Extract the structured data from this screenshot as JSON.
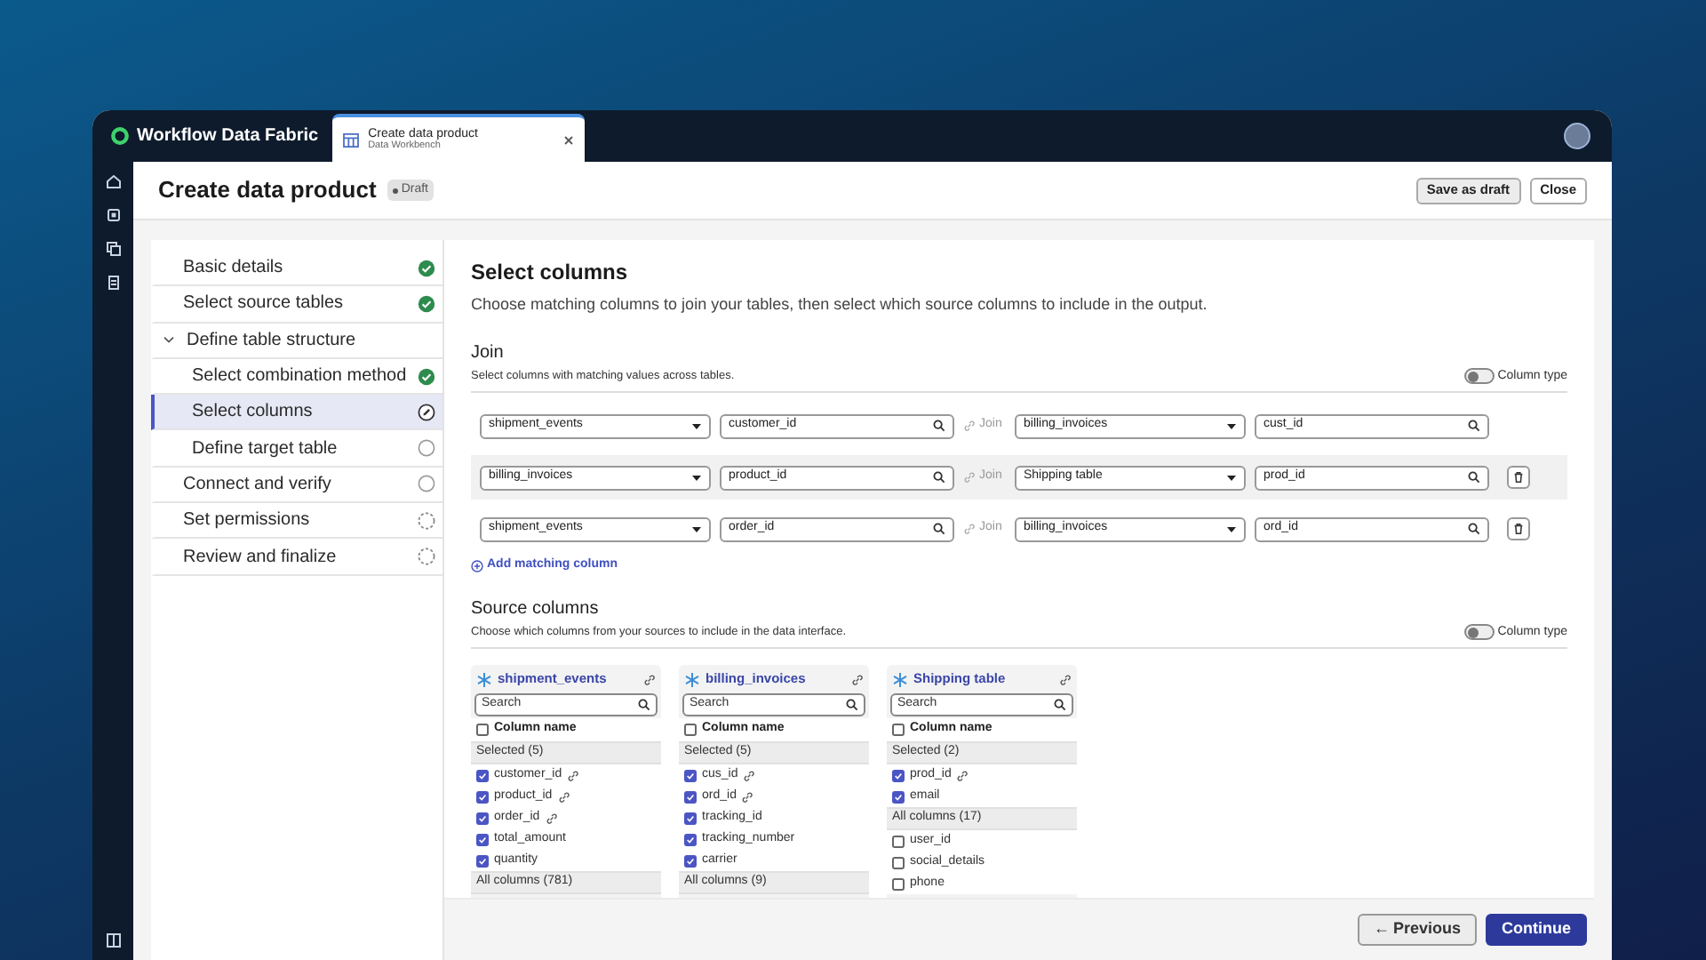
{
  "app": {
    "name": "Workflow Data Fabric"
  },
  "tabs": [
    {
      "title": "Create data product",
      "subtitle": "Data Workbench",
      "selected": true
    }
  ],
  "header": {
    "title": "Create data product",
    "badge": "Draft",
    "buttons": [
      "Save as draft",
      "Close"
    ]
  },
  "steps": [
    {
      "label": "Basic details",
      "kind": "done",
      "selected": false
    },
    {
      "label": "Select source tables",
      "kind": "done",
      "selected": false
    },
    {
      "label": "Define table structure",
      "expanded": true,
      "selected": false,
      "children": [
        {
          "label": "Select combination method",
          "kind": "done",
          "selected": false
        },
        {
          "label": "Select columns",
          "kind": "current",
          "selected": true
        },
        {
          "label": "Define target table",
          "kind": "pending",
          "selected": false
        }
      ]
    },
    {
      "label": "Connect and verify",
      "kind": "pending",
      "selected": false
    },
    {
      "label": "Set permissions",
      "kind": "locked",
      "selected": false
    },
    {
      "label": "Review and finalize",
      "kind": "locked",
      "selected": false
    }
  ],
  "page": {
    "title": "Select columns",
    "description": "Choose matching columns to join your tables, then select which source columns to include in the output."
  },
  "join": {
    "title": "Join",
    "description": "Select columns with matching values across tables.",
    "toggle": {
      "label": "Column type",
      "on": false
    },
    "rows": [
      {
        "left_table": "shipment_events",
        "left_column": "customer_id",
        "join_label": "Join",
        "right_table": "billing_invoices",
        "right_column": "cust_id",
        "deletable": false,
        "highlighted": false
      },
      {
        "left_table": "billing_invoices",
        "left_column": "product_id",
        "join_label": "Join",
        "right_table": "Shipping table",
        "right_column": "prod_id",
        "deletable": true,
        "highlighted": true
      },
      {
        "left_table": "shipment_events",
        "left_column": "order_id",
        "join_label": "Join",
        "right_table": "billing_invoices",
        "right_column": "ord_id",
        "deletable": true,
        "highlighted": false
      }
    ],
    "add_label": "Add matching column"
  },
  "source": {
    "title": "Source columns",
    "description": "Choose which columns from your sources to include in the data interface.",
    "toggle": {
      "label": "Column type",
      "on": false
    },
    "tables": [
      {
        "name": "shipment_events",
        "search_placeholder": "Search",
        "header": "Column name",
        "header_checked": false,
        "groups": [
          {
            "label": "Selected (5)",
            "items": [
              {
                "name": "customer_id",
                "checked": true,
                "linked": true
              },
              {
                "name": "product_id",
                "checked": true,
                "linked": true
              },
              {
                "name": "order_id",
                "checked": true,
                "linked": true
              },
              {
                "name": "total_amount",
                "checked": true,
                "linked": false
              },
              {
                "name": "quantity",
                "checked": true,
                "linked": false
              }
            ]
          },
          {
            "label": "All columns (781)"
          }
        ]
      },
      {
        "name": "billing_invoices",
        "search_placeholder": "Search",
        "header": "Column name",
        "header_checked": false,
        "groups": [
          {
            "label": "Selected (5)",
            "items": [
              {
                "name": "cus_id",
                "checked": true,
                "linked": true
              },
              {
                "name": "ord_id",
                "checked": true,
                "linked": true
              },
              {
                "name": "tracking_id",
                "checked": true,
                "linked": false
              },
              {
                "name": "tracking_number",
                "checked": true,
                "linked": false
              },
              {
                "name": "carrier",
                "checked": true,
                "linked": false
              }
            ]
          },
          {
            "label": "All columns (9)"
          }
        ]
      },
      {
        "name": "Shipping table",
        "search_placeholder": "Search",
        "header": "Column name",
        "header_checked": false,
        "groups": [
          {
            "label": "Selected (2)",
            "items": [
              {
                "name": "prod_id",
                "checked": true,
                "linked": true
              },
              {
                "name": "email",
                "checked": true,
                "linked": false
              }
            ]
          },
          {
            "label": "All columns (17)",
            "items": [
              {
                "name": "user_id",
                "checked": false,
                "linked": false
              },
              {
                "name": "social_details",
                "checked": false,
                "linked": false
              },
              {
                "name": "phone",
                "checked": false,
                "linked": false
              }
            ]
          }
        ]
      }
    ]
  },
  "footer": {
    "previous": "Previous",
    "previous_icon": "←",
    "continue": "Continue"
  }
}
